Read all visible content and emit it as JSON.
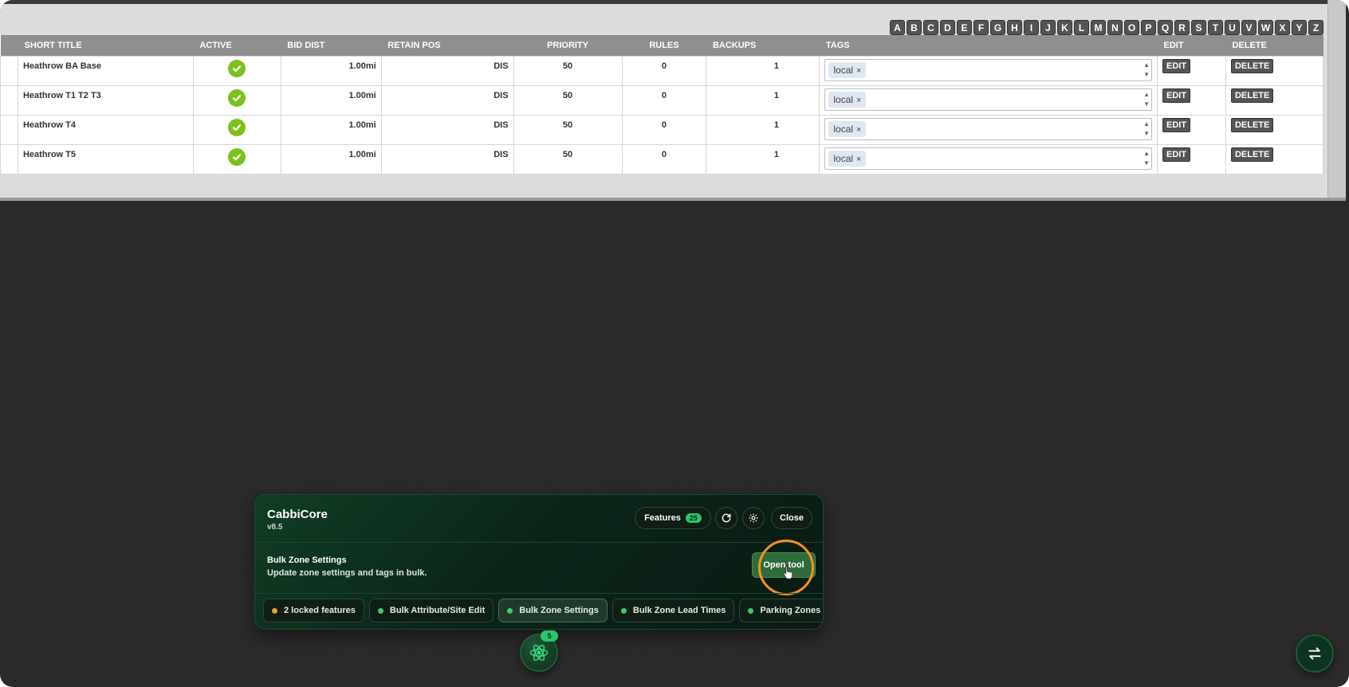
{
  "alphabet": [
    "A",
    "B",
    "C",
    "D",
    "E",
    "F",
    "G",
    "H",
    "I",
    "J",
    "K",
    "L",
    "M",
    "N",
    "O",
    "P",
    "Q",
    "R",
    "S",
    "T",
    "U",
    "V",
    "W",
    "X",
    "Y",
    "Z"
  ],
  "table": {
    "headers": [
      "SHORT TITLE",
      "ACTIVE",
      "BID DIST",
      "RETAIN POS",
      "PRIORITY",
      "RULES",
      "BACKUPS",
      "TAGS",
      "EDIT",
      "DELETE"
    ],
    "rows": [
      {
        "title": "Heathrow BA Base",
        "bid_dist": "1.00mi",
        "retain_pos": "DIS",
        "priority": "50",
        "rules": "0",
        "backups": "1",
        "tag": "local",
        "edit": "EDIT",
        "delete": "DELETE"
      },
      {
        "title": "Heathrow T1 T2 T3",
        "bid_dist": "1.00mi",
        "retain_pos": "DIS",
        "priority": "50",
        "rules": "0",
        "backups": "1",
        "tag": "local",
        "edit": "EDIT",
        "delete": "DELETE"
      },
      {
        "title": "Heathrow T4",
        "bid_dist": "1.00mi",
        "retain_pos": "DIS",
        "priority": "50",
        "rules": "0",
        "backups": "1",
        "tag": "local",
        "edit": "EDIT",
        "delete": "DELETE"
      },
      {
        "title": "Heathrow T5",
        "bid_dist": "1.00mi",
        "retain_pos": "DIS",
        "priority": "50",
        "rules": "0",
        "backups": "1",
        "tag": "local",
        "edit": "EDIT",
        "delete": "DELETE"
      }
    ]
  },
  "panel": {
    "title": "CabbiCore",
    "version": "v8.5",
    "features_label": "Features",
    "features_count": "25",
    "close_label": "Close",
    "tool_name": "Bulk Zone Settings",
    "tool_desc": "Update zone settings and tags in bulk.",
    "open_tool_label": "Open tool",
    "chips": [
      {
        "label": "2 locked features",
        "status": "amber"
      },
      {
        "label": "Bulk Attribute/Site Edit",
        "status": "green"
      },
      {
        "label": "Bulk Zone Settings",
        "status": "green",
        "active": true
      },
      {
        "label": "Bulk Zone Lead Times",
        "status": "green"
      },
      {
        "label": "Parking Zones",
        "status": "green"
      }
    ]
  },
  "launcher": {
    "badge": "5"
  },
  "colors": {
    "accent_green": "#2cc66a",
    "highlight_ring": "#f7931e",
    "check_green": "#7cc11c"
  }
}
